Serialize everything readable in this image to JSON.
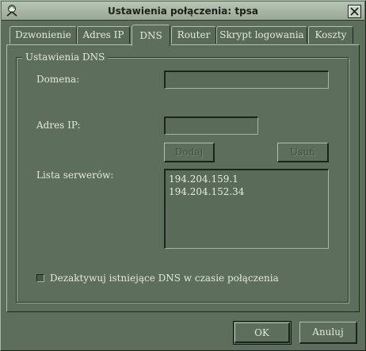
{
  "window": {
    "title": "Ustawienia połączenia: tpsa"
  },
  "tabs": [
    {
      "label": "Dzwonienie"
    },
    {
      "label": "Adres IP"
    },
    {
      "label": "DNS"
    },
    {
      "label": "Router"
    },
    {
      "label": "Skrypt logowania"
    },
    {
      "label": "Koszty"
    }
  ],
  "dns": {
    "group_title": "Ustawienia DNS",
    "domain_label": "Domena:",
    "domain_value": "",
    "ip_label": "Adres IP:",
    "ip_value": "",
    "add_button": "Dodaj",
    "remove_button": "Usuń",
    "servers_label": "Lista serwerów:",
    "servers": [
      "194.204.159.1",
      "194.204.152.34"
    ],
    "disable_existing_label": "Dezaktywuj istniejące DNS w czasie połączenia",
    "disable_existing_checked": false
  },
  "footer": {
    "ok_button": "OK",
    "cancel_button": "Anuluj"
  }
}
